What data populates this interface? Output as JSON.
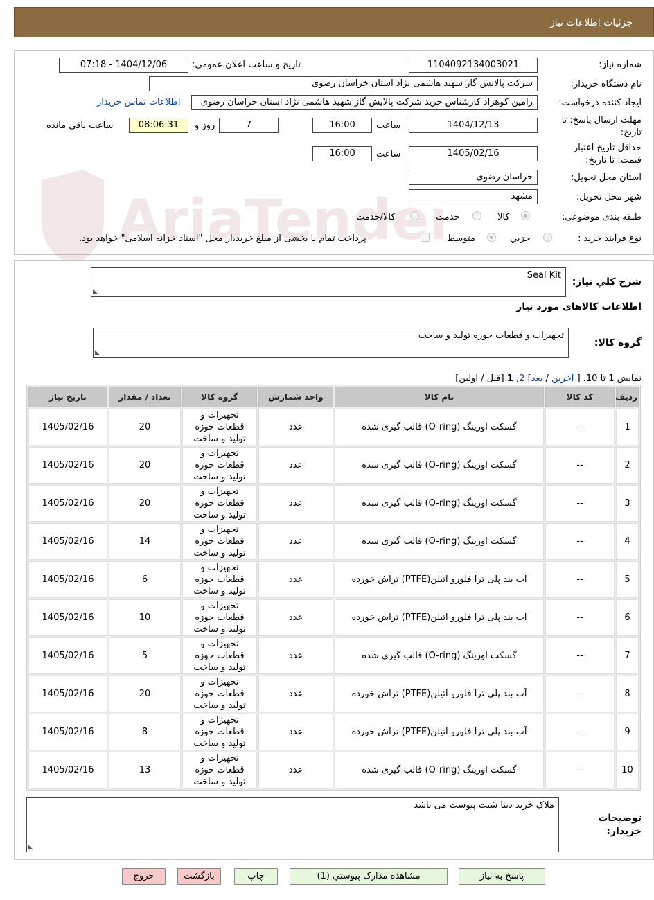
{
  "header": {
    "title": "جزئیات اطلاعات نیاز"
  },
  "watermark": {
    "text": "AriaTender.net"
  },
  "info": {
    "need_number_label": "شماره نیاز:",
    "need_number": "1104092134003021",
    "announce_label": "تاریخ و ساعت اعلان عمومی:",
    "announce_value": "1404/12/06 - 07:18",
    "buyer_org_label": "نام دستگاه خریدار:",
    "buyer_org": "شرکت پالایش گاز شهید هاشمی نژاد   استان خراسان رضوی",
    "requester_label": "ایجاد کننده درخواست:",
    "requester": "رامین کوهزاد کارشناس خرید شرکت پالایش گاز شهید هاشمی نژاد   استان خراسان رضوی",
    "contact_link": "اطلاعات تماس خریدار",
    "deadline_label_1": "مهلت ارسال پاسخ: تا",
    "deadline_label_2": "تاریخ:",
    "deadline_date": "1404/12/13",
    "time_label": "ساعت",
    "deadline_time": "16:00",
    "days_value": "7",
    "days_label": "روز و",
    "remaining_time": "08:06:31",
    "remaining_label": "ساعت باقي مانده",
    "validity_label_1": "حداقل تاریخ اعتبار",
    "validity_label_2": "قیمت: تا تاریخ:",
    "validity_date": "1405/02/16",
    "validity_time": "16:00",
    "province_label": "استان محل تحویل:",
    "province": "خراسان رضوی",
    "city_label": "شهر محل تحویل:",
    "city": "مشهد",
    "category_label": "طبقه بندی موضوعی:",
    "category_options": [
      "کالا",
      "خدمت",
      "کالا/خدمت"
    ],
    "process_label": "نوع فرآیند خرید :",
    "process_options": [
      "جزیي",
      "متوسط"
    ],
    "payment_note": "پرداخت تمام یا بخشی از مبلغ خرید،از محل \"اسناد خزانه اسلامی\" خواهد بود."
  },
  "description": {
    "label": "شرح کلي نیاز:",
    "value": "Seal Kit",
    "goods_info_title": "اطلاعات کالاهای مورد نیاز",
    "group_label": "گروه کالا:",
    "group_value": "تجهیزات و قطعات حوزه تولید و ساخت"
  },
  "pagination": {
    "summary": "نمایش 1 تا 10. [",
    "last": "آخرین",
    "sep1": "/",
    "next": "بعد",
    "close1": "]",
    "page2": "2",
    "comma": ",",
    "page1": "1",
    "rest": "[قبل / اولین]"
  },
  "table": {
    "headers": [
      "ردیف",
      "کد کالا",
      "نام کالا",
      "واحد شمارش",
      "گروه کالا",
      "تعداد / مقدار",
      "تاریخ نیاز"
    ],
    "rows": [
      [
        "1",
        "--",
        "گسکت اورینگ (O-ring) قالب گیری شده",
        "عدد",
        "تجهیزات و قطعات حوزه تولید و ساخت",
        "20",
        "1405/02/16"
      ],
      [
        "2",
        "--",
        "گسکت اورینگ (O-ring) قالب گیری شده",
        "عدد",
        "تجهیزات و قطعات حوزه تولید و ساخت",
        "20",
        "1405/02/16"
      ],
      [
        "3",
        "--",
        "گسکت اورینگ (O-ring) قالب گیری شده",
        "عدد",
        "تجهیزات و قطعات حوزه تولید و ساخت",
        "20",
        "1405/02/16"
      ],
      [
        "4",
        "--",
        "گسکت اورینگ (O-ring) قالب گیری شده",
        "عدد",
        "تجهیزات و قطعات حوزه تولید و ساخت",
        "14",
        "1405/02/16"
      ],
      [
        "5",
        "--",
        "آب بند پلی ترا فلورو اتیلن(PTFE) تراش خورده",
        "عدد",
        "تجهیزات و قطعات حوزه تولید و ساخت",
        "6",
        "1405/02/16"
      ],
      [
        "6",
        "--",
        "آب بند پلی ترا فلورو اتیلن(PTFE) تراش خورده",
        "عدد",
        "تجهیزات و قطعات حوزه تولید و ساخت",
        "10",
        "1405/02/16"
      ],
      [
        "7",
        "--",
        "گسکت اورینگ (O-ring) قالب گیری شده",
        "عدد",
        "تجهیزات و قطعات حوزه تولید و ساخت",
        "5",
        "1405/02/16"
      ],
      [
        "8",
        "--",
        "آب بند پلی ترا فلورو اتیلن(PTFE) تراش خورده",
        "عدد",
        "تجهیزات و قطعات حوزه تولید و ساخت",
        "20",
        "1405/02/16"
      ],
      [
        "9",
        "--",
        "آب بند پلی ترا فلورو اتیلن(PTFE) تراش خورده",
        "عدد",
        "تجهیزات و قطعات حوزه تولید و ساخت",
        "8",
        "1405/02/16"
      ],
      [
        "10",
        "--",
        "گسکت اورینگ (O-ring) قالب گیری شده",
        "عدد",
        "تجهیزات و قطعات حوزه تولید و ساخت",
        "13",
        "1405/02/16"
      ]
    ]
  },
  "notes": {
    "label_1": "توضیحات",
    "label_2": "خریدار:",
    "value": "ملاک خرید دیتا شیت پیوست می باشد"
  },
  "buttons": {
    "reply": "پاسخ به نیاز",
    "attachments": "مشاهده مدارک پیوستي (1)",
    "print": "چاپ",
    "back": "بازگشت",
    "exit": "خروج"
  },
  "colors": {
    "header_bg": "#8b6b40",
    "highlight": "#ffffcc",
    "green_button": "#e6f7dd",
    "pink_button": "#f7c9c9",
    "link": "#0645ad"
  }
}
